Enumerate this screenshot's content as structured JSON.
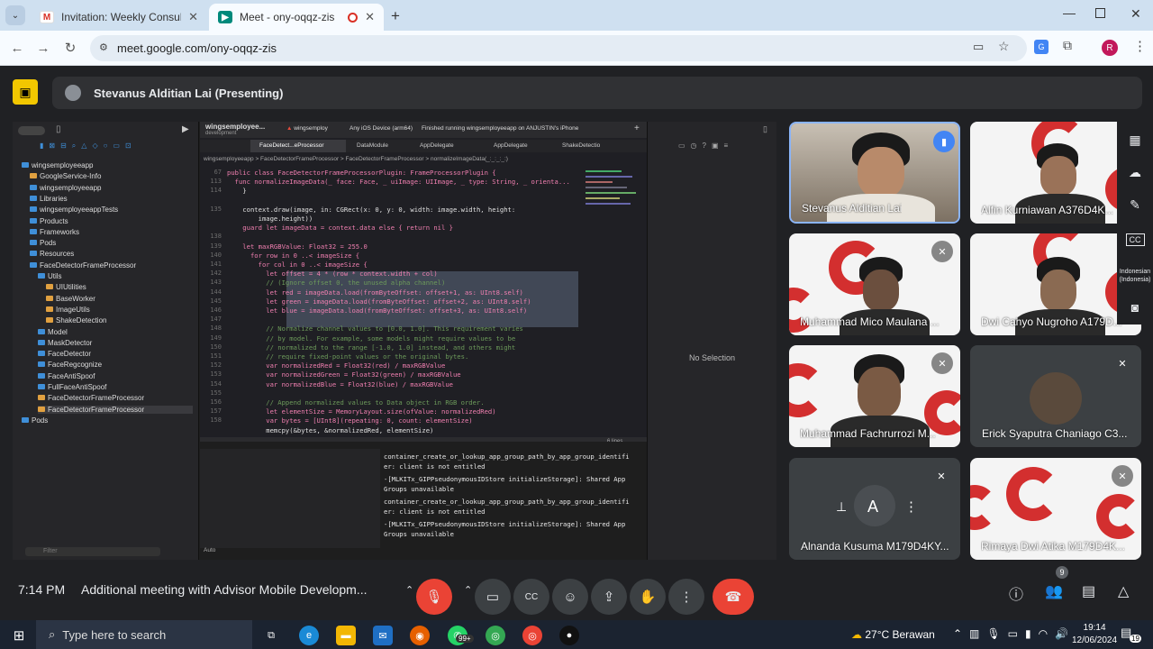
{
  "browser": {
    "tabs": [
      {
        "title": "Invitation: Weekly Consultation",
        "favicon": "gmail-icon"
      },
      {
        "title": "Meet - ony-oqqz-zis",
        "favicon": "meet-icon"
      }
    ],
    "url": "meet.google.com/ony-oqqz-zis",
    "profile_initial": "R"
  },
  "meet": {
    "presenter_label": "Stevanus Alditian Lai (Presenting)",
    "time": "7:14 PM",
    "meeting_title": "Additional meeting with Advisor Mobile Developm...",
    "participant_count": "9",
    "accent": "#8ab4f8",
    "end_call_color": "#ea4335",
    "participants": [
      {
        "name": "Stevanus Alditian Lai",
        "speaking": true
      },
      {
        "name": "Alfin Kurniawan A376D4K..."
      },
      {
        "name": "Muhammad Mico Maulana ..."
      },
      {
        "name": "Dwi Cahyo Nugroho A179D..."
      },
      {
        "name": "Muhammad Fachrurrozi M..."
      },
      {
        "name": "Erick Syaputra Chaniago C3..."
      },
      {
        "name": "Alnanda Kusuma M179D4KY..."
      },
      {
        "name": "Rimaya Dwi Atika M179D4K..."
      }
    ],
    "language_label_1": "Indonesian",
    "language_label_2": "(Indonesia)"
  },
  "xcode": {
    "project": "wingsemployee...",
    "project_sub": "development",
    "scheme": "wingsemploy",
    "device": "Any iOS Device (arm64)",
    "status": "Finished running wingsemployeeapp on ANJUSTIN's iPhone",
    "tabs": [
      "FaceDetect...eProcessor",
      "DataModule",
      "AppDelegate",
      "AppDelegate",
      "ShakeDetectio"
    ],
    "breadcrumb": "wingsemployeeapp  >  FaceDetectorFrameProcessor  >  FaceDetectorFrameProcessor  >  normalizeImageData(_:_:_:_:)",
    "tree": [
      "wingsemployeeapp",
      "GoogleService-Info",
      "wingsemployeeapp",
      "Libraries",
      "wingsemployeeappTests",
      "Products",
      "Frameworks",
      "Pods",
      "Resources",
      "FaceDetectorFrameProcessor",
      "Utils",
      "UIUtilities",
      "BaseWorker",
      "ImageUtils",
      "ShakeDetection",
      "Model",
      "MaskDetector",
      "FaceDetector",
      "FaceRegcognize",
      "FaceAntiSpoof",
      "FullFaceAntiSpoof",
      "FaceDetectorFrameProcessor",
      "FaceDetectorFrameProcessor",
      "Pods"
    ],
    "line_numbers": [
      "67",
      "113",
      "114",
      "",
      "135",
      "",
      "",
      "138",
      "139",
      "140",
      "141",
      "142",
      "143",
      "144",
      "145",
      "146",
      "147",
      "148",
      "149",
      "150",
      "151",
      "152",
      "153",
      "154",
      "155",
      "156",
      "157",
      "158"
    ],
    "code_lines": [
      "public class FaceDetectorFrameProcessorPlugin: FrameProcessorPlugin {",
      "  func normalizeImageData(_ face: Face, _ uiImage: UIImage, _ type: String, _ orienta...",
      "    }",
      "",
      "    context.draw(image, in: CGRect(x: 0, y: 0, width: image.width, height:",
      "        image.height))",
      "    guard let imageData = context.data else { return nil }",
      "",
      "    let maxRGBValue: Float32 = 255.0",
      "      for row in 0 ..< imageSize {",
      "        for col in 0 ..< imageSize {",
      "          let offset = 4 * (row * context.width + col)",
      "          // (Ignore offset 0, the unused alpha channel)",
      "          let red = imageData.load(fromByteOffset: offset+1, as: UInt8.self)",
      "          let green = imageData.load(fromByteOffset: offset+2, as: UInt8.self)",
      "          let blue = imageData.load(fromByteOffset: offset+3, as: UInt8.self)",
      "",
      "          // Normalize channel values to [0.0, 1.0]. This requirement varies",
      "          // by model. For example, some models might require values to be",
      "          // normalized to the range [-1.0, 1.0] instead, and others might",
      "          // require fixed-point values or the original bytes.",
      "          var normalizedRed = Float32(red) / maxRGBValue",
      "          var normalizedGreen = Float32(green) / maxRGBValue",
      "          var normalizedBlue = Float32(blue) / maxRGBValue",
      "",
      "          // Append normalized values to Data object in RGB order.",
      "          let elementSize = MemoryLayout.size(ofValue: normalizedRed)",
      "          var bytes = [UInt8](repeating: 0, count: elementSize)",
      "          memcpy(&bytes, &normalizedRed, elementSize)"
    ],
    "console": [
      "container_create_or_lookup_app_group_path_by_app_group_identifi",
      "er: client is not entitled",
      "-[MLKITx_GIPPseudonymousIDStore initializeStorage]: Shared App",
      "Groups unavailable",
      "container_create_or_lookup_app_group_path_by_app_group_identifi",
      "er: client is not entitled",
      "-[MLKITx_GIPPseudonymousIDStore initializeStorage]: Shared App",
      "Groups unavailable"
    ],
    "lines_label": "6 lines",
    "auto_label": "Auto",
    "filter_placeholder": "Filter",
    "no_selection": "No Selection"
  },
  "taskbar": {
    "search_placeholder": "Type here to search",
    "badge": "99+",
    "weather": "27°C  Berawan",
    "clock_time": "19:14",
    "clock_date": "12/06/2024",
    "notif_count": "19"
  }
}
